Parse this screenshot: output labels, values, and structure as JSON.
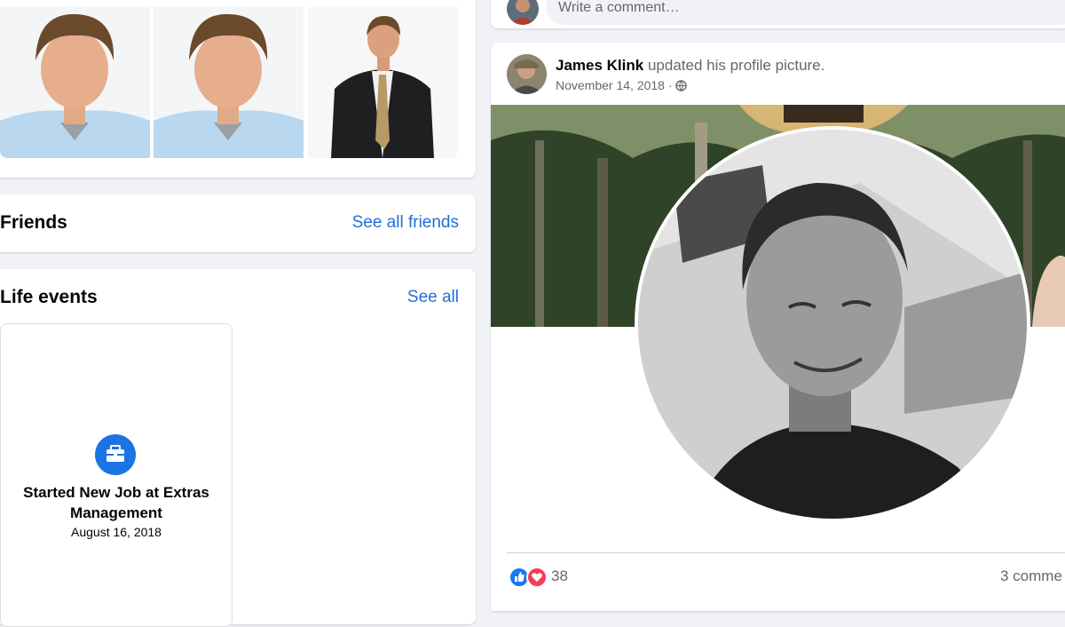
{
  "friends": {
    "title": "Friends",
    "see_all": "See all friends"
  },
  "life_events": {
    "title": "Life events",
    "see_all": "See all",
    "event": {
      "title": "Started New Job at Extras Management",
      "date": "August 16, 2018",
      "icon": "briefcase-icon"
    }
  },
  "comment_box": {
    "placeholder": "Write a comment…"
  },
  "post": {
    "author": "James Klink",
    "action": " updated his profile picture.",
    "date": "November 14, 2018",
    "date_separator": " · ",
    "reaction_count": "38",
    "comments": "3 comme"
  },
  "colors": {
    "accent": "#1b74e4",
    "link": "#216fdb",
    "like": "#1877f2",
    "love": "#f33e58"
  }
}
